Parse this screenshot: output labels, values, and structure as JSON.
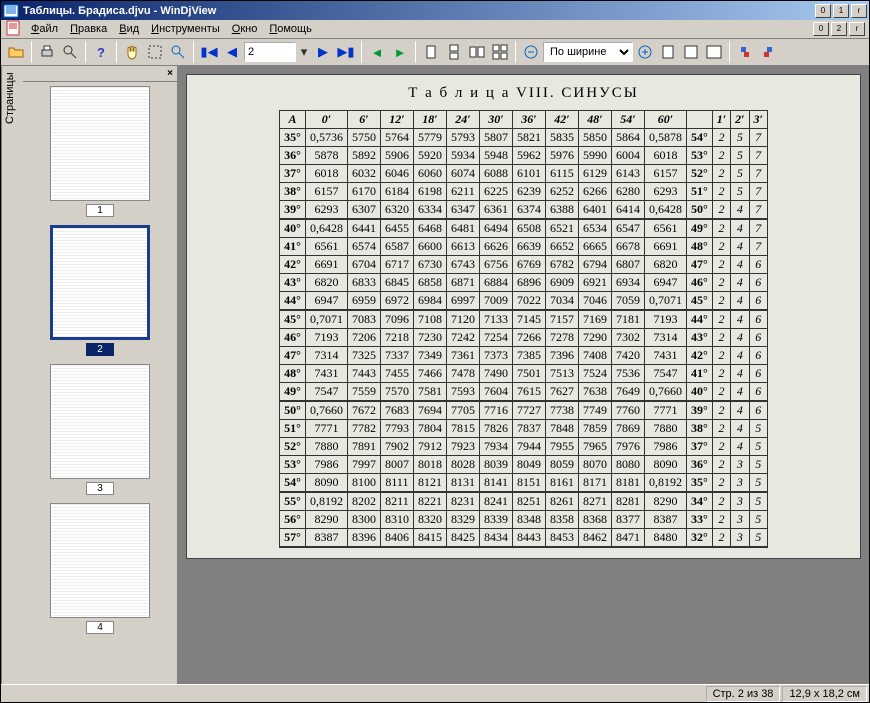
{
  "window": {
    "title": "Таблицы. Брадиса.djvu - WinDjView"
  },
  "menu": {
    "file": "Файл",
    "edit": "Правка",
    "view": "Вид",
    "tools": "Инструменты",
    "window": "Окно",
    "help": "Помощь"
  },
  "toolbar": {
    "page_value": "2",
    "zoom_mode": "По ширине"
  },
  "sidebar": {
    "tab": "Страницы",
    "thumbs": [
      {
        "label": "1",
        "sel": false
      },
      {
        "label": "2",
        "sel": true
      },
      {
        "label": "3",
        "sel": false
      },
      {
        "label": "4",
        "sel": false
      }
    ]
  },
  "status": {
    "page": "Стр. 2 из 38",
    "size": "12,9 x 18,2 см"
  },
  "doc": {
    "title": "Т а б л и ц а  VIII.  СИНУСЫ",
    "col_headers": [
      "A",
      "0′",
      "6′",
      "12′",
      "18′",
      "24′",
      "30′",
      "36′",
      "42′",
      "48′",
      "54′",
      "60′",
      "",
      "1′",
      "2′",
      "3′"
    ],
    "groups": [
      [
        [
          "35°",
          "0,5736",
          "5750",
          "5764",
          "5779",
          "5793",
          "5807",
          "5821",
          "5835",
          "5850",
          "5864",
          "0,5878",
          "54°",
          "2",
          "5",
          "7"
        ],
        [
          "36°",
          "5878",
          "5892",
          "5906",
          "5920",
          "5934",
          "5948",
          "5962",
          "5976",
          "5990",
          "6004",
          "6018",
          "53°",
          "2",
          "5",
          "7"
        ],
        [
          "37°",
          "6018",
          "6032",
          "6046",
          "6060",
          "6074",
          "6088",
          "6101",
          "6115",
          "6129",
          "6143",
          "6157",
          "52°",
          "2",
          "5",
          "7"
        ],
        [
          "38°",
          "6157",
          "6170",
          "6184",
          "6198",
          "6211",
          "6225",
          "6239",
          "6252",
          "6266",
          "6280",
          "6293",
          "51°",
          "2",
          "5",
          "7"
        ],
        [
          "39°",
          "6293",
          "6307",
          "6320",
          "6334",
          "6347",
          "6361",
          "6374",
          "6388",
          "6401",
          "6414",
          "0,6428",
          "50°",
          "2",
          "4",
          "7"
        ]
      ],
      [
        [
          "40°",
          "0,6428",
          "6441",
          "6455",
          "6468",
          "6481",
          "6494",
          "6508",
          "6521",
          "6534",
          "6547",
          "6561",
          "49°",
          "2",
          "4",
          "7"
        ],
        [
          "41°",
          "6561",
          "6574",
          "6587",
          "6600",
          "6613",
          "6626",
          "6639",
          "6652",
          "6665",
          "6678",
          "6691",
          "48°",
          "2",
          "4",
          "7"
        ],
        [
          "42°",
          "6691",
          "6704",
          "6717",
          "6730",
          "6743",
          "6756",
          "6769",
          "6782",
          "6794",
          "6807",
          "6820",
          "47°",
          "2",
          "4",
          "6"
        ],
        [
          "43°",
          "6820",
          "6833",
          "6845",
          "6858",
          "6871",
          "6884",
          "6896",
          "6909",
          "6921",
          "6934",
          "6947",
          "46°",
          "2",
          "4",
          "6"
        ],
        [
          "44°",
          "6947",
          "6959",
          "6972",
          "6984",
          "6997",
          "7009",
          "7022",
          "7034",
          "7046",
          "7059",
          "0,7071",
          "45°",
          "2",
          "4",
          "6"
        ]
      ],
      [
        [
          "45°",
          "0,7071",
          "7083",
          "7096",
          "7108",
          "7120",
          "7133",
          "7145",
          "7157",
          "7169",
          "7181",
          "7193",
          "44°",
          "2",
          "4",
          "6"
        ],
        [
          "46°",
          "7193",
          "7206",
          "7218",
          "7230",
          "7242",
          "7254",
          "7266",
          "7278",
          "7290",
          "7302",
          "7314",
          "43°",
          "2",
          "4",
          "6"
        ],
        [
          "47°",
          "7314",
          "7325",
          "7337",
          "7349",
          "7361",
          "7373",
          "7385",
          "7396",
          "7408",
          "7420",
          "7431",
          "42°",
          "2",
          "4",
          "6"
        ],
        [
          "48°",
          "7431",
          "7443",
          "7455",
          "7466",
          "7478",
          "7490",
          "7501",
          "7513",
          "7524",
          "7536",
          "7547",
          "41°",
          "2",
          "4",
          "6"
        ],
        [
          "49°",
          "7547",
          "7559",
          "7570",
          "7581",
          "7593",
          "7604",
          "7615",
          "7627",
          "7638",
          "7649",
          "0,7660",
          "40°",
          "2",
          "4",
          "6"
        ]
      ],
      [
        [
          "50°",
          "0,7660",
          "7672",
          "7683",
          "7694",
          "7705",
          "7716",
          "7727",
          "7738",
          "7749",
          "7760",
          "7771",
          "39°",
          "2",
          "4",
          "6"
        ],
        [
          "51°",
          "7771",
          "7782",
          "7793",
          "7804",
          "7815",
          "7826",
          "7837",
          "7848",
          "7859",
          "7869",
          "7880",
          "38°",
          "2",
          "4",
          "5"
        ],
        [
          "52°",
          "7880",
          "7891",
          "7902",
          "7912",
          "7923",
          "7934",
          "7944",
          "7955",
          "7965",
          "7976",
          "7986",
          "37°",
          "2",
          "4",
          "5"
        ],
        [
          "53°",
          "7986",
          "7997",
          "8007",
          "8018",
          "8028",
          "8039",
          "8049",
          "8059",
          "8070",
          "8080",
          "8090",
          "36°",
          "2",
          "3",
          "5"
        ],
        [
          "54°",
          "8090",
          "8100",
          "8111",
          "8121",
          "8131",
          "8141",
          "8151",
          "8161",
          "8171",
          "8181",
          "0,8192",
          "35°",
          "2",
          "3",
          "5"
        ]
      ],
      [
        [
          "55°",
          "0,8192",
          "8202",
          "8211",
          "8221",
          "8231",
          "8241",
          "8251",
          "8261",
          "8271",
          "8281",
          "8290",
          "34°",
          "2",
          "3",
          "5"
        ],
        [
          "56°",
          "8290",
          "8300",
          "8310",
          "8320",
          "8329",
          "8339",
          "8348",
          "8358",
          "8368",
          "8377",
          "8387",
          "33°",
          "2",
          "3",
          "5"
        ],
        [
          "57°",
          "8387",
          "8396",
          "8406",
          "8415",
          "8425",
          "8434",
          "8443",
          "8453",
          "8462",
          "8471",
          "8480",
          "32°",
          "2",
          "3",
          "5"
        ]
      ]
    ]
  }
}
